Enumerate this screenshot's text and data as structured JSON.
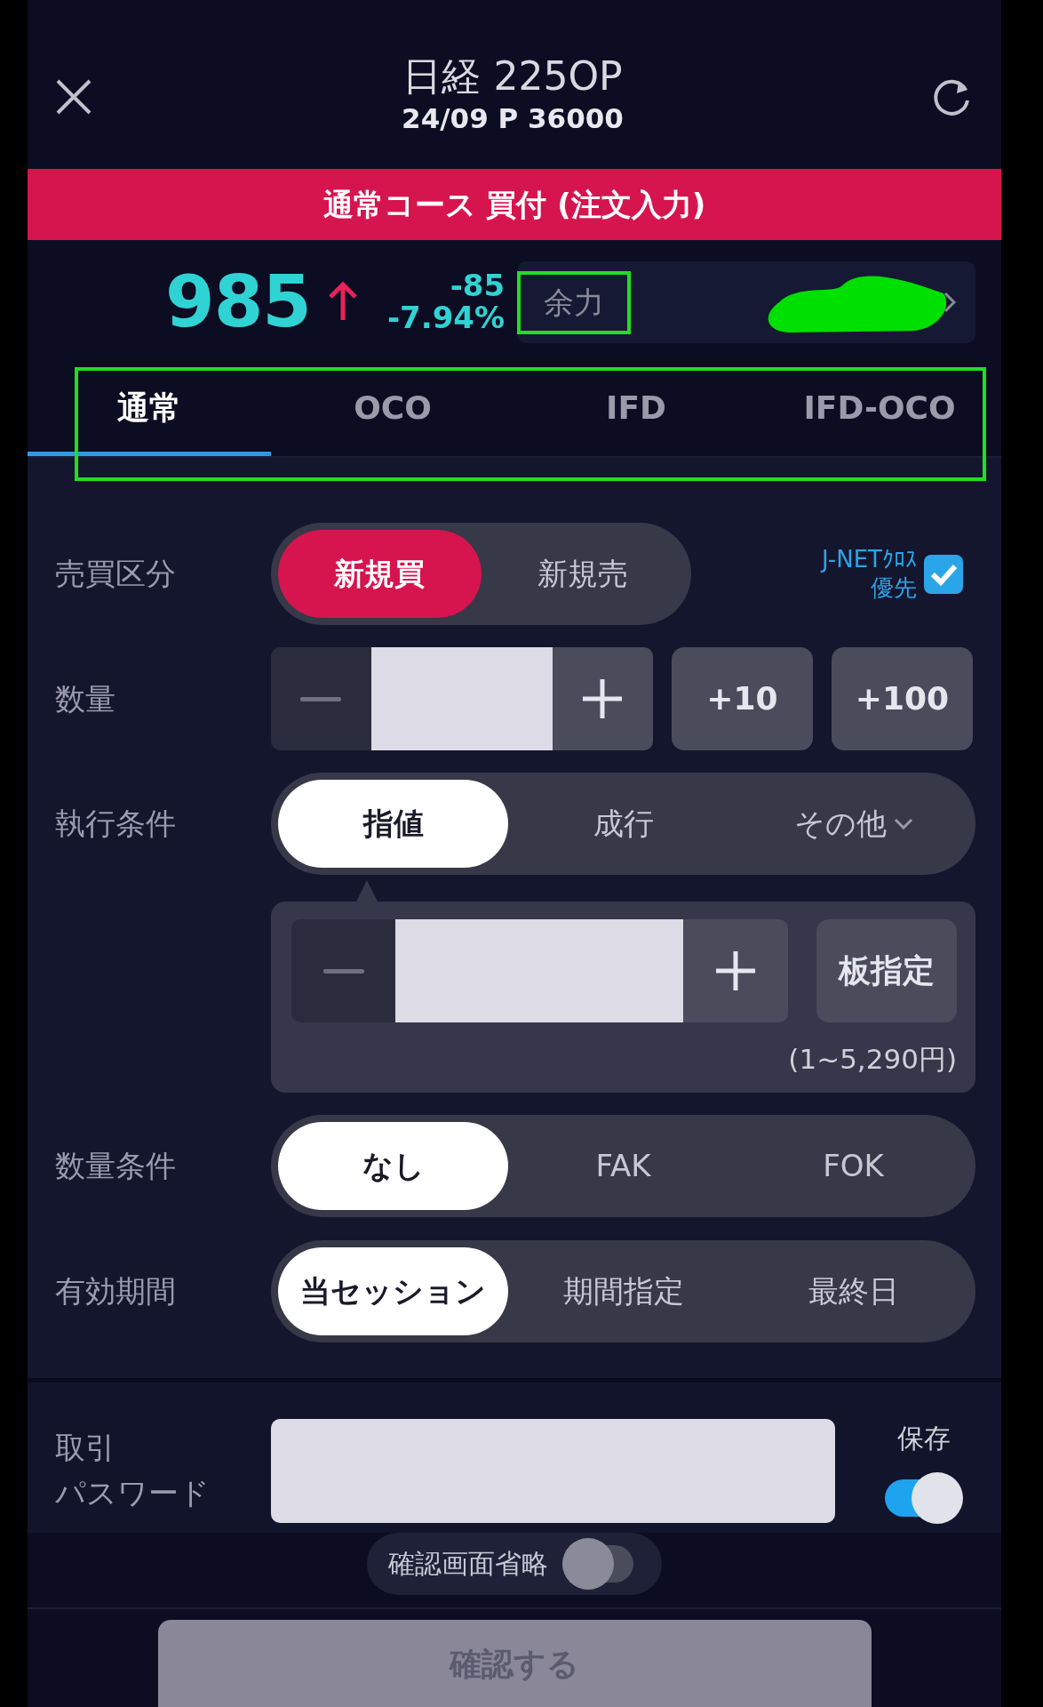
{
  "header": {
    "title": "日経 225OP",
    "subtitle": "24/09 P 36000"
  },
  "order_banner": "通常コース 買付 (注文入力)",
  "quote": {
    "price": "985",
    "rising": true,
    "change": "-85",
    "change_pct": "-7.94%",
    "buying_power_label": "余力",
    "buying_power_label_highlighted": true,
    "buying_power_redacted": true
  },
  "tabs_highlighted": true,
  "tabs": [
    {
      "label": "通常",
      "selected": true
    },
    {
      "label": "OCO",
      "selected": false
    },
    {
      "label": "IFD",
      "selected": false
    },
    {
      "label": "IFD-OCO",
      "selected": false
    }
  ],
  "side": {
    "label": "売買区分",
    "options": [
      {
        "label": "新規買",
        "selected": true
      },
      {
        "label": "新規売",
        "selected": false
      }
    ],
    "jnet": {
      "lines": [
        "J-NETｸﾛｽ",
        "優先"
      ],
      "checked": true
    }
  },
  "quantity": {
    "label": "数量",
    "step_buttons": [
      "+10",
      "+100"
    ]
  },
  "execution": {
    "label": "執行条件",
    "options": [
      {
        "label": "指値",
        "selected": true,
        "kind": "option"
      },
      {
        "label": "成行",
        "selected": false,
        "kind": "option"
      },
      {
        "label": "その他",
        "selected": false,
        "kind": "dropdown"
      }
    ],
    "board_button": "板指定",
    "price_range": "(1~5,290円)"
  },
  "quantity_condition": {
    "label": "数量条件",
    "options": [
      {
        "label": "なし",
        "selected": true
      },
      {
        "label": "FAK",
        "selected": false
      },
      {
        "label": "FOK",
        "selected": false
      }
    ]
  },
  "validity": {
    "label": "有効期間",
    "options": [
      {
        "label": "当セッション",
        "selected": true
      },
      {
        "label": "期間指定",
        "selected": false
      },
      {
        "label": "最終日",
        "selected": false
      }
    ]
  },
  "password": {
    "label_lines": [
      "取引",
      "パスワード"
    ],
    "save_label": "保存",
    "save_on": true
  },
  "skip_confirm": {
    "label": "確認画面省略",
    "on": false
  },
  "confirm_button": {
    "label": "確認する",
    "disabled": true
  }
}
